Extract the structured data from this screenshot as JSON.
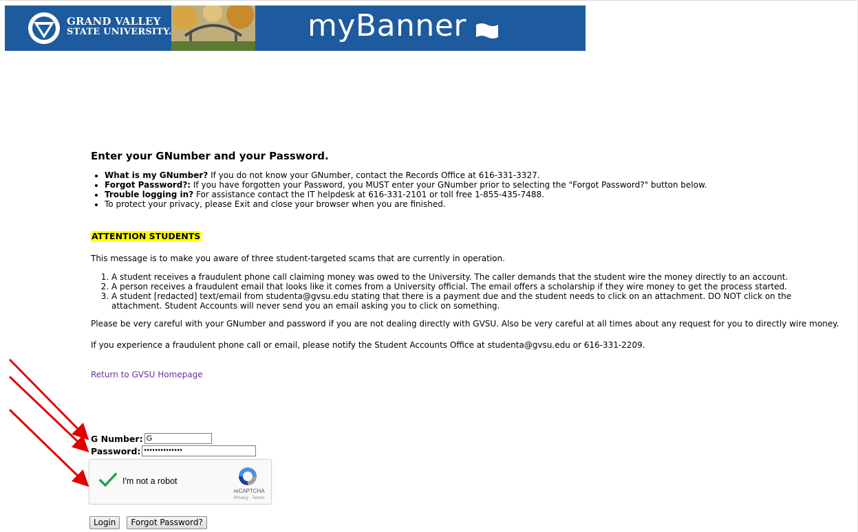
{
  "header": {
    "university_line1": "GRAND VALLEY",
    "university_line2": "STATE UNIVERSITY.",
    "app_title": "myBanner",
    "banner_color": "#1e5a9e"
  },
  "main": {
    "title": "Enter your GNumber and your Password.",
    "info": [
      {
        "bold": "What is my GNumber?",
        "text": " If you do not know your GNumber, contact the Records Office at 616-331-3327."
      },
      {
        "bold": "Forgot Password?:",
        "text": " If you have forgotten your Password, you MUST enter your GNumber prior to selecting the \"Forgot Password?\" button below."
      },
      {
        "bold": "Trouble logging in?",
        "text": " For assistance contact the IT helpdesk at 616-331-2101 or toll free 1-855-435-7488."
      },
      {
        "bold": "",
        "text": "To protect your privacy, please Exit and close your browser when you are finished."
      }
    ],
    "attention": "ATTENTION STUDENTS",
    "intro": "This message is to make you aware of three student-targeted scams that are currently in operation.",
    "scams": [
      "A student receives a fraudulent phone call claiming money was owed to the University. The caller demands that the student wire the money directly to an account.",
      "A person receives a fraudulent email that looks like it comes from a University official. The email offers a scholarship if they wire money to get the process started.",
      "A student [redacted] text/email from studenta@gvsu.edu stating that there is a payment due and the student needs to click on an attachment. DO NOT click on the attachment. Student Accounts will never send you an email asking you to click on something."
    ],
    "careful": "Please be very careful with your GNumber and password if you are not dealing directly with GVSU. Also be very careful at all times about any request for you to directly wire money.",
    "notify": "If you experience a fraudulent phone call or email, please notify the Student Accounts Office at studenta@gvsu.edu or 616-331-2209.",
    "home_link": "Return to GVSU Homepage"
  },
  "form": {
    "gnumber_label": "G Number:",
    "gnumber_value": "G",
    "password_label": "Password:",
    "password_value": "••••••••••••••",
    "captcha_label": "I'm not a robot",
    "captcha_brand": "reCAPTCHA",
    "captcha_links": "Privacy - Terms",
    "login_button": "Login",
    "forgot_button": "Forgot Password?"
  },
  "colors": {
    "attention_highlight": "#ffff00",
    "link": "#6b2fa0",
    "annotation_arrows": "#e00000"
  }
}
